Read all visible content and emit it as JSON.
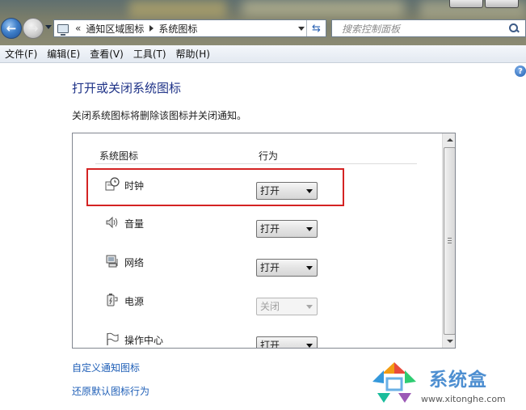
{
  "address": {
    "separator": "«",
    "crumbs": [
      "通知区域图标",
      "系统图标"
    ],
    "search_placeholder": "搜索控制面板"
  },
  "menu": [
    "文件(F)",
    "编辑(E)",
    "查看(V)",
    "工具(T)",
    "帮助(H)"
  ],
  "page": {
    "title": "打开或关闭系统图标",
    "description": "关闭系统图标将删除该图标并关闭通知。"
  },
  "table": {
    "headers": [
      "系统图标",
      "行为"
    ],
    "rows": [
      {
        "icon": "clock-icon",
        "label": "时钟",
        "value": "打开",
        "enabled": true
      },
      {
        "icon": "volume-icon",
        "label": "音量",
        "value": "打开",
        "enabled": true
      },
      {
        "icon": "network-icon",
        "label": "网络",
        "value": "打开",
        "enabled": true
      },
      {
        "icon": "power-icon",
        "label": "电源",
        "value": "关闭",
        "enabled": false
      },
      {
        "icon": "action-center-flag-icon",
        "label": "操作中心",
        "value": "打开",
        "enabled": true
      }
    ]
  },
  "links": {
    "customize": "自定义通知图标",
    "restore": "还原默认图标行为"
  },
  "watermark": {
    "name": "系统盒",
    "url": "www.xitonghe.com"
  },
  "colors": {
    "title_blue": "#1e3287",
    "link_blue": "#1f5fb7",
    "highlight_red": "#d42323"
  }
}
